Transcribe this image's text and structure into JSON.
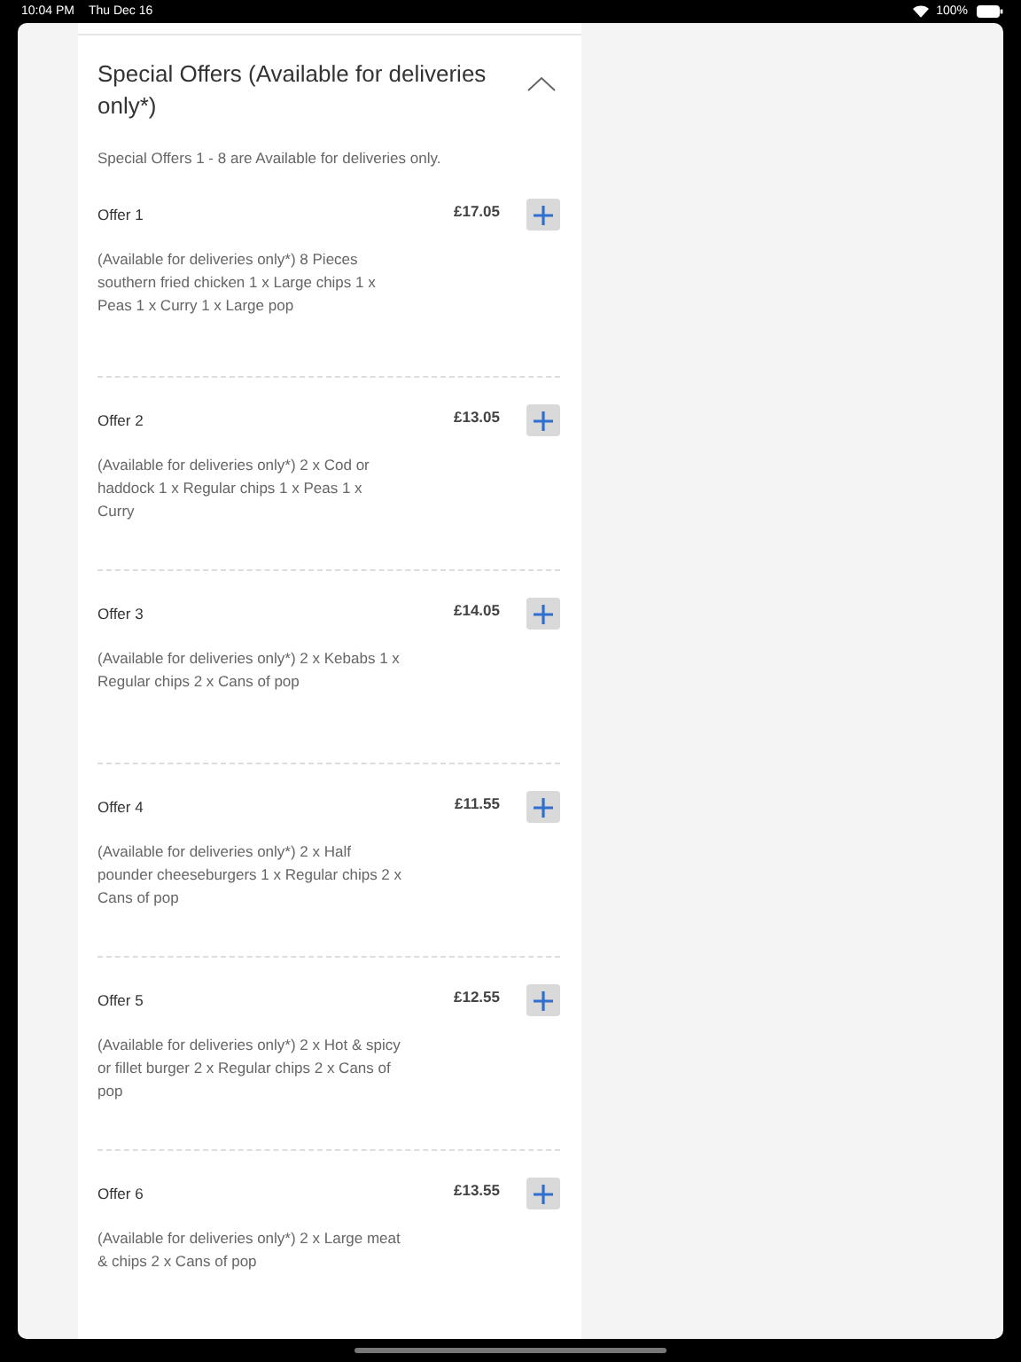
{
  "status_bar": {
    "time": "10:04 PM",
    "date": "Thu Dec 16",
    "battery": "100%"
  },
  "section": {
    "title": "Special Offers (Available for deliveries only*)",
    "expanded": true,
    "note": "Special Offers 1 - 8 are Available for deliveries only.",
    "offers": [
      {
        "name": "Offer 1",
        "price": "£17.05",
        "description": "(Available for deliveries only*) 8 Pieces southern fried chicken 1 x Large chips 1 x Peas 1 x Curry 1 x Large pop"
      },
      {
        "name": "Offer 2",
        "price": "£13.05",
        "description": "(Available for deliveries only*) 2 x Cod or haddock 1 x Regular chips 1 x Peas 1 x Curry"
      },
      {
        "name": "Offer 3",
        "price": "£14.05",
        "description": "(Available for deliveries only*) 2 x Kebabs 1 x Regular chips 2 x Cans of pop"
      },
      {
        "name": "Offer 4",
        "price": "£11.55",
        "description": "(Available for deliveries only*) 2 x Half pounder cheeseburgers 1 x Regular chips 2 x Cans of pop"
      },
      {
        "name": "Offer 5",
        "price": "£12.55",
        "description": "(Available for deliveries only*) 2 x Hot & spicy or fillet burger 2 x Regular chips 2 x Cans of pop"
      },
      {
        "name": "Offer 6",
        "price": "£13.55",
        "description": "(Available for deliveries only*) 2 x Large meat & chips 2 x Cans of pop"
      }
    ]
  }
}
